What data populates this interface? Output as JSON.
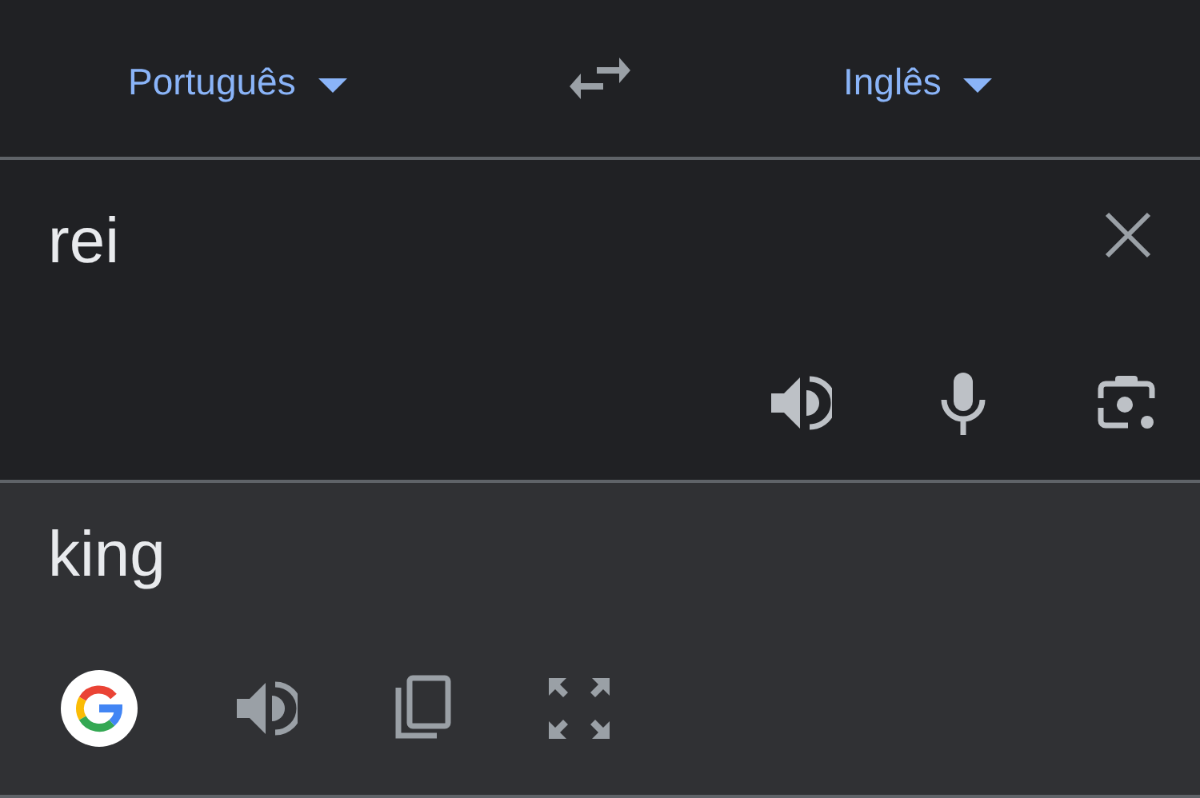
{
  "language_bar": {
    "source_language": "Português",
    "target_language": "Inglês"
  },
  "input": {
    "text": "rei"
  },
  "output": {
    "text": "king"
  }
}
